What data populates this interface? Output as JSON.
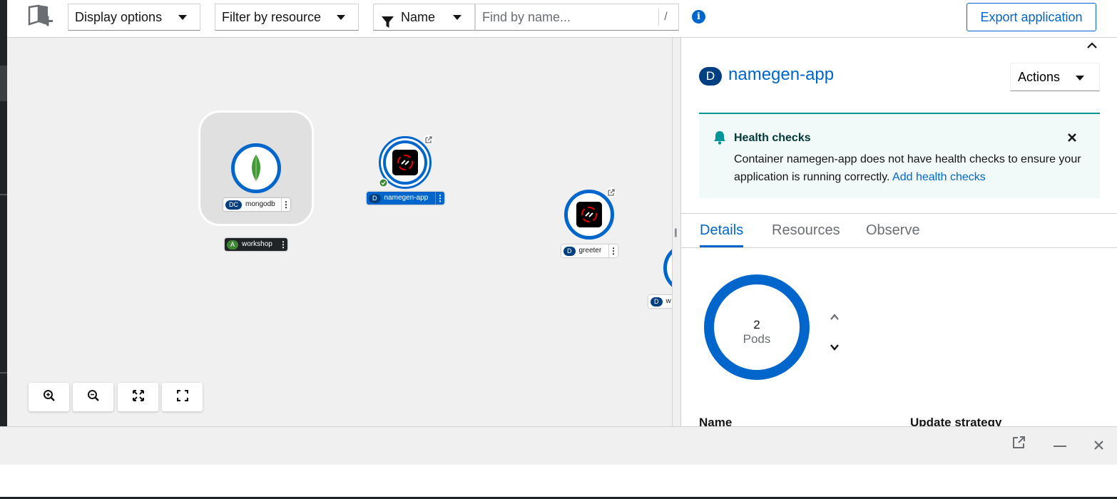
{
  "toolbar": {
    "display_options": "Display options",
    "filter_by_resource": "Filter by resource",
    "filter_type": "Name",
    "search_placeholder": "Find by name...",
    "search_hint": "/",
    "export_button": "Export application"
  },
  "topology": {
    "nodes": [
      {
        "badge": "DC",
        "label": "mongodb"
      },
      {
        "badge": "D",
        "label": "namegen-app",
        "selected": true
      },
      {
        "badge": "D",
        "label": "greeter"
      },
      {
        "badge": "D",
        "label": "w"
      }
    ],
    "application_group": {
      "badge": "A",
      "label": "workshop"
    },
    "zoom_controls": [
      "zoom-in",
      "zoom-out",
      "reset-view",
      "fit-to-screen"
    ]
  },
  "side_panel": {
    "badge": "D",
    "title": "namegen-app",
    "actions_label": "Actions",
    "alert": {
      "title": "Health checks",
      "body": "Container namegen-app does not have health checks to ensure your application is running correctly.",
      "link": "Add health checks"
    },
    "tabs": [
      "Details",
      "Resources",
      "Observe"
    ],
    "active_tab": "Details",
    "pods": {
      "count": "2",
      "label": "Pods"
    },
    "details": {
      "name_header": "Name",
      "update_strategy_header": "Update strategy"
    }
  },
  "colors": {
    "accent": "#0066cc",
    "badge": "#004080",
    "alert_border": "#009596",
    "app_badge": "#3e8635"
  }
}
